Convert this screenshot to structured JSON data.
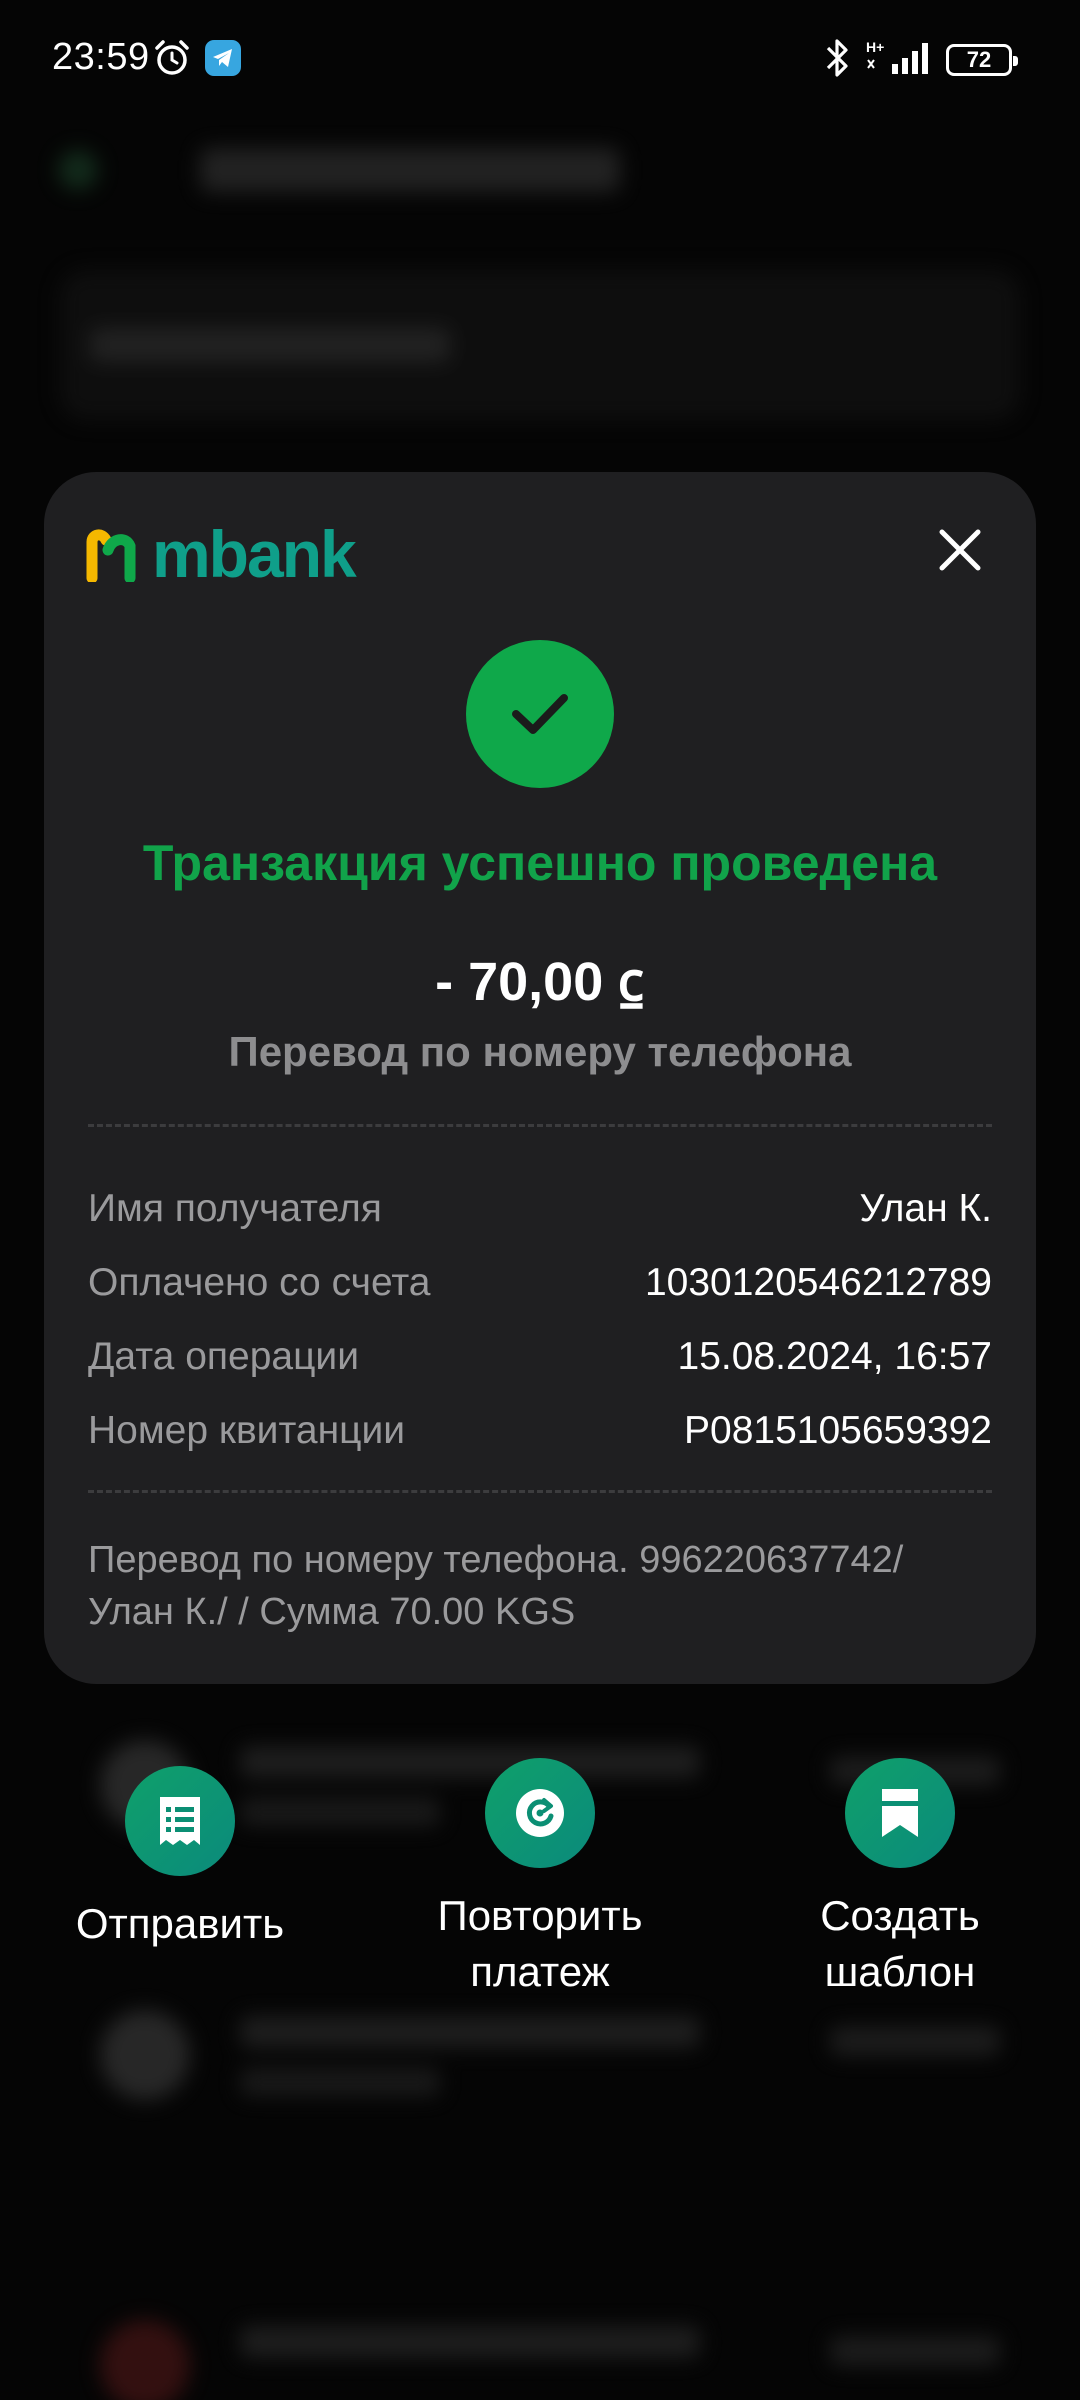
{
  "status_bar": {
    "time": "23:59",
    "network": "H+",
    "battery": "72",
    "icons": [
      "alarm-icon",
      "telegram-icon",
      "bluetooth-icon",
      "signal-icon",
      "battery-icon"
    ]
  },
  "receipt": {
    "brand": "mbank",
    "title": "Транзакция успешно проведена",
    "amount": "- 70,00 ⃀",
    "subtitle": "Перевод по номеру телефона",
    "details": [
      {
        "label": "Имя получателя",
        "value": "Улан К."
      },
      {
        "label": "Оплачено со счета",
        "value": "1030120546212789"
      },
      {
        "label": "Дата операции",
        "value": "15.08.2024, 16:57"
      },
      {
        "label": "Номер квитанции",
        "value": "P0815105659392"
      }
    ],
    "note": "Перевод по номеру телефона. 996220637742/ Улан К./ / Сумма 70.00 KGS"
  },
  "actions": {
    "send": "Отправить",
    "repeat": "Повторить платеж",
    "template": "Создать шаблон"
  },
  "colors": {
    "success": "#11a34a",
    "brand_teal": "#0f9f8a",
    "brand_yellow": "#f5b800",
    "card_bg": "#1f1f21"
  }
}
